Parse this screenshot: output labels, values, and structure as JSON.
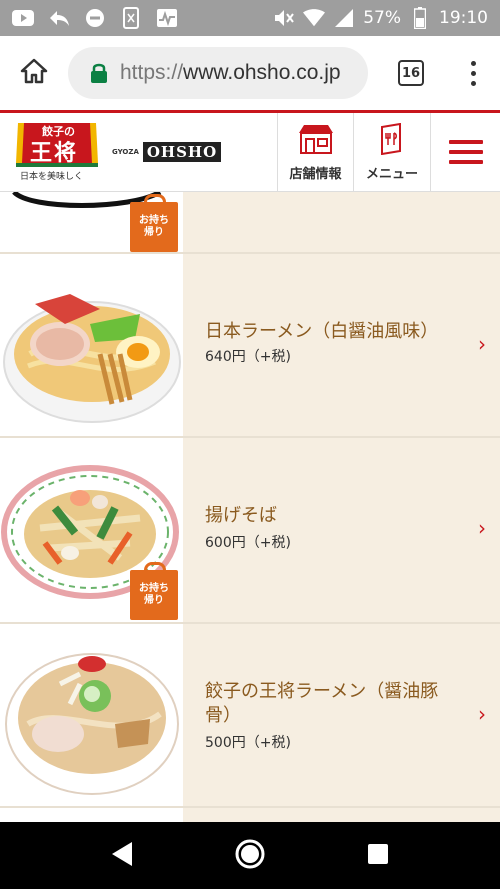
{
  "status_bar": {
    "battery": "57%",
    "time": "19:10"
  },
  "browser": {
    "url_scheme": "https://",
    "url_host": "www.ohsho.co.jp",
    "tab_count": "16"
  },
  "header": {
    "logo_line1": "餃子の",
    "logo_line2": "王将",
    "logo_tagline": "日本を美味しく",
    "gyoza_label": "GYOZA",
    "gyoza_brand": "OHSHO",
    "store_label": "店舗情報",
    "menu_label": "メニュー"
  },
  "takeout_badge": {
    "line1": "お持ち",
    "line2": "帰り"
  },
  "items": [
    {
      "name": "日本ラーメン（白醤油風味）",
      "price": "640円（+税)"
    },
    {
      "name": "揚げそば",
      "price": "600円（+税)"
    },
    {
      "name": "餃子の王将ラーメン（醤油豚骨）",
      "price": "500円（+税)"
    }
  ],
  "colors": {
    "brand_red": "#c8161d",
    "item_bg": "#f6eee1",
    "name_text": "#8a5a1f",
    "takeout_orange": "#e36a1c",
    "status_bar_gray": "#9e9e9e"
  }
}
